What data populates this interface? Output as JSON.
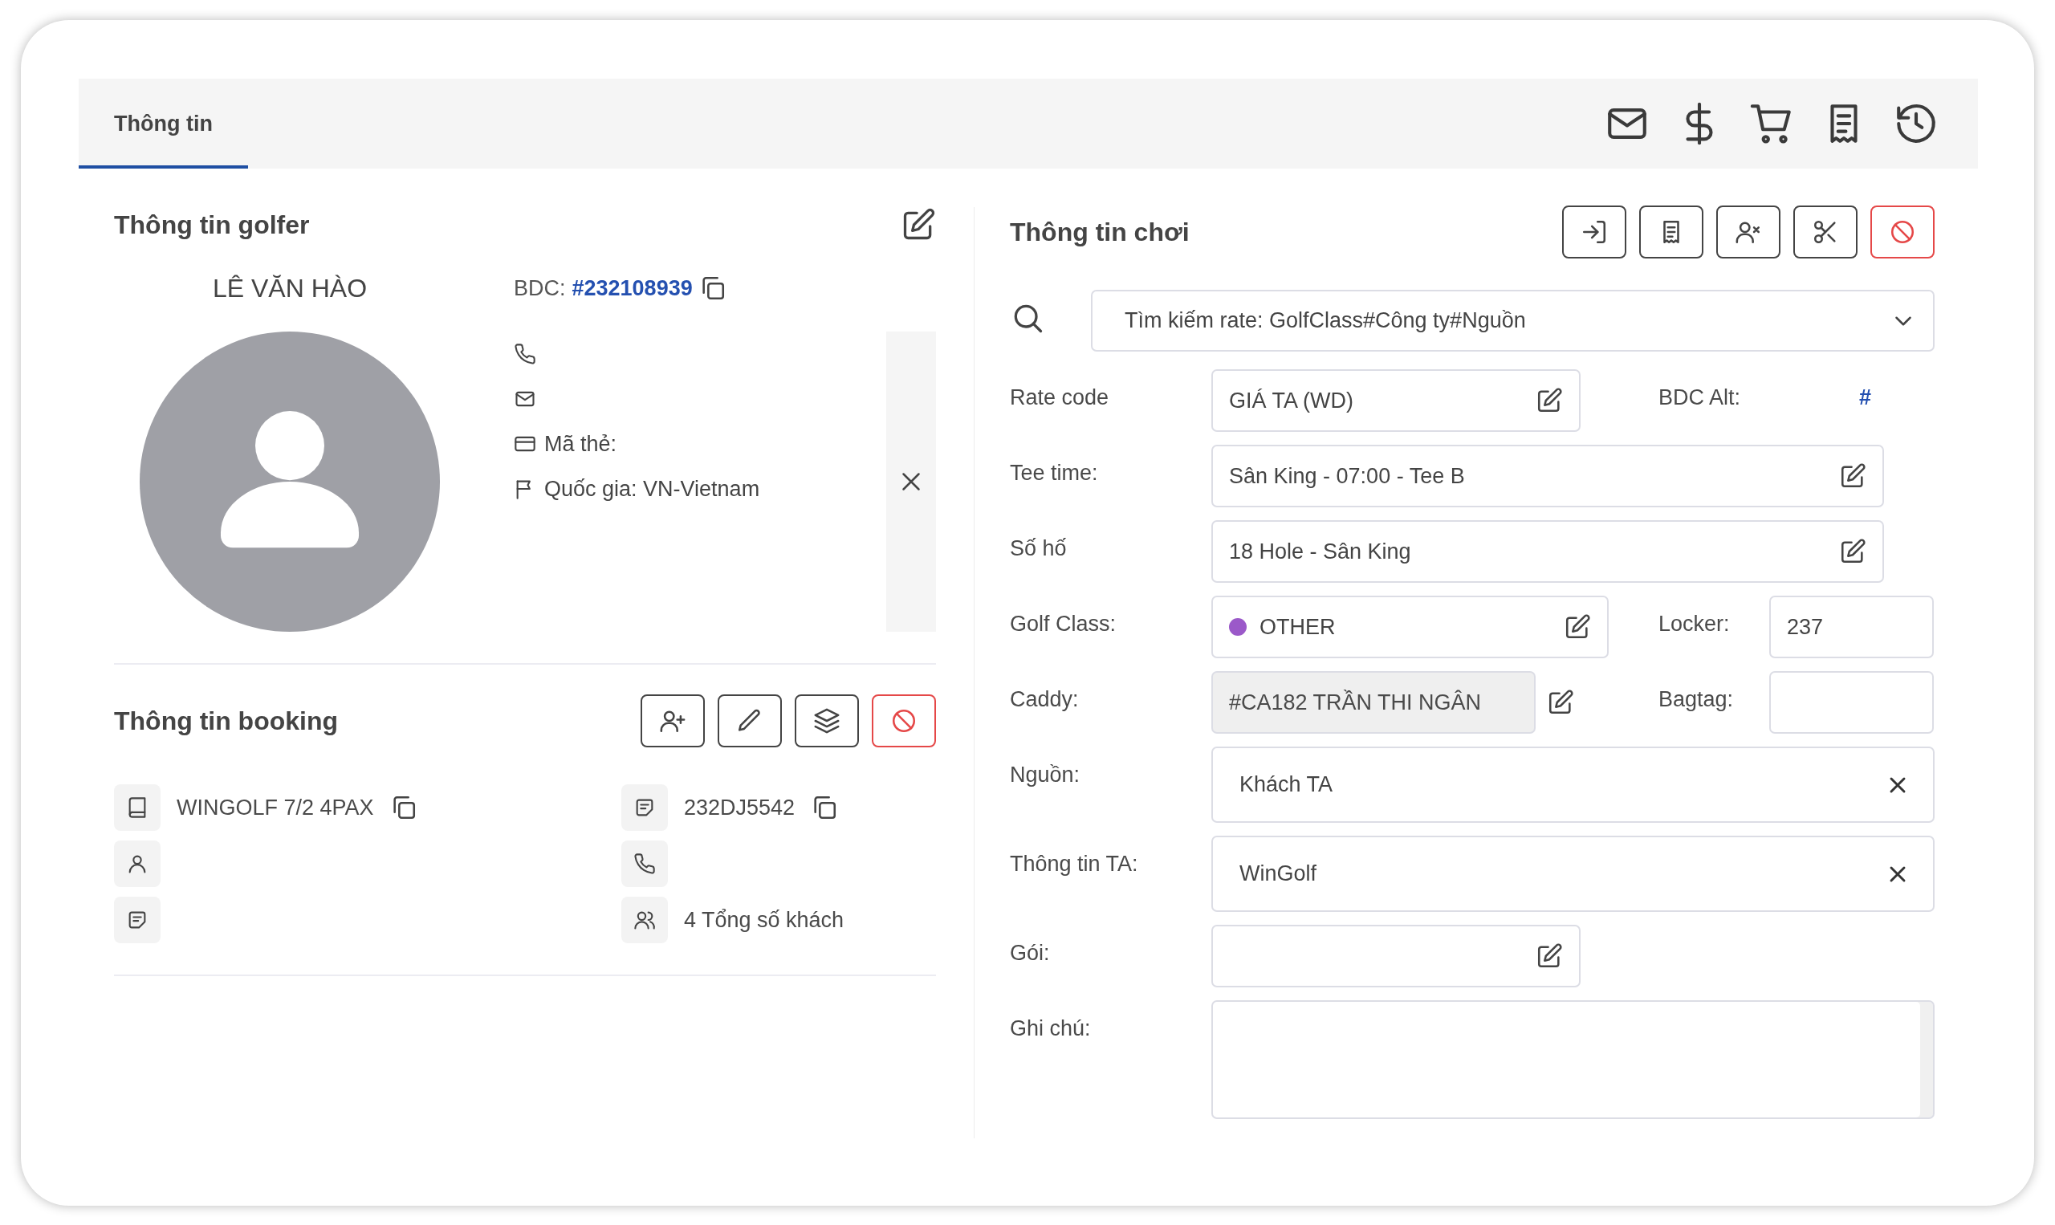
{
  "tabs": [
    {
      "label": "Thông tin",
      "selected": true
    }
  ],
  "golfer": {
    "title": "Thông tin golfer",
    "name": "LÊ VĂN HÀO",
    "bdc_label": "BDC:",
    "bdc": "#232108939",
    "contacts": [
      {
        "kind": "phone"
      },
      {
        "kind": "email"
      },
      {
        "kind": "card",
        "text": "Mã thẻ:"
      },
      {
        "kind": "country",
        "text": "Quốc gia: VN-Vietnam"
      }
    ]
  },
  "booking": {
    "title": "Thông tin booking",
    "items": [
      {
        "kind": "book",
        "text": "WINGOLF 7/2 4PAX",
        "copyable": true
      },
      {
        "kind": "note",
        "text": "232DJ5542",
        "copyable": true
      },
      {
        "kind": "person",
        "copyable": false
      },
      {
        "kind": "phone",
        "copyable": false
      },
      {
        "kind": "note",
        "copyable": false
      },
      {
        "kind": "guests",
        "text": "4 Tổng số khách",
        "copyable": false
      }
    ]
  },
  "play": {
    "title": "Thông tin chơi",
    "search": {
      "placeholder": "Tìm kiếm rate: GolfClass#Công ty#Nguồn"
    },
    "rate_code": {
      "label": "Rate code",
      "value": "GIÁ TA (WD)"
    },
    "bdc_alt": {
      "label": "BDC Alt:",
      "value": "#"
    },
    "tee_time": {
      "label": "Tee time:",
      "value": "Sân King - 07:00 - Tee B"
    },
    "holes": {
      "label": "Số hố",
      "value": "18 Hole - Sân King"
    },
    "golf_class": {
      "label": "Golf Class:",
      "value": "OTHER",
      "color": "#9b59c9"
    },
    "locker": {
      "label": "Locker:",
      "value": "237"
    },
    "caddy": {
      "label": "Caddy:",
      "value": "#CA182 TRẦN THI NGÂN",
      "disabled": true
    },
    "bagtag": {
      "label": "Bagtag:"
    },
    "source": {
      "label": "Nguồn:",
      "value": "Khách TA"
    },
    "ta_info": {
      "label": "Thông tin TA:",
      "value": "WinGolf"
    },
    "package": {
      "label": "Gói:"
    },
    "note": {
      "label": "Ghi chú:"
    }
  }
}
